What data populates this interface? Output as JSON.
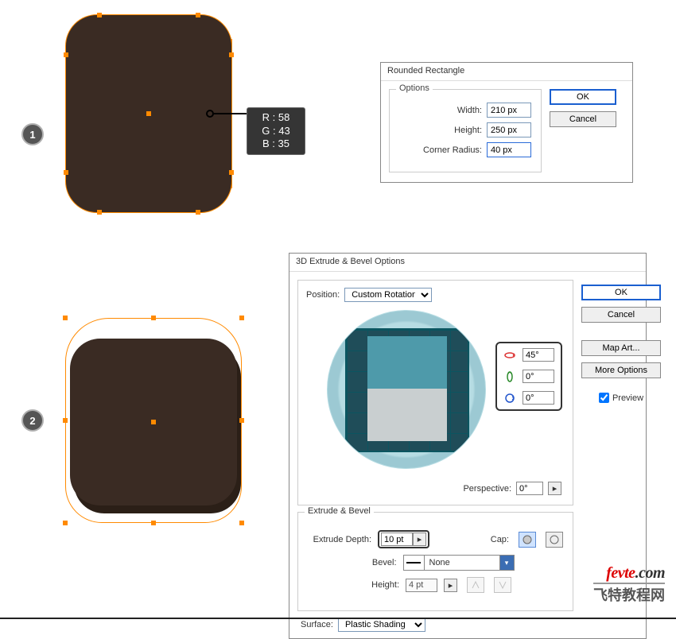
{
  "color_sample": {
    "r": "R : 58",
    "g": "G : 43",
    "b": "B : 35",
    "hex": "#3a2b23"
  },
  "steps": {
    "one": "1",
    "two": "2"
  },
  "dialog_rr": {
    "title": "Rounded Rectangle",
    "fieldset": "Options",
    "width_label": "Width:",
    "width_value": "210 px",
    "height_label": "Height:",
    "height_value": "250 px",
    "radius_label": "Corner Radius:",
    "radius_value": "40 px",
    "ok": "OK",
    "cancel": "Cancel"
  },
  "dialog_3d": {
    "title": "3D Extrude & Bevel Options",
    "position_label": "Position:",
    "position_value": "Custom Rotation",
    "rot_x": "45°",
    "rot_y": "0°",
    "rot_z": "0°",
    "perspective_label": "Perspective:",
    "perspective_value": "0°",
    "eb_legend": "Extrude & Bevel",
    "extrude_label": "Extrude Depth:",
    "extrude_value": "10 pt",
    "cap_label": "Cap:",
    "bevel_label": "Bevel:",
    "bevel_value": "None",
    "height_label": "Height:",
    "height_value": "4 pt",
    "surface_label": "Surface:",
    "surface_value": "Plastic Shading",
    "ok": "OK",
    "cancel": "Cancel",
    "map_art": "Map Art...",
    "more_options": "More Options",
    "preview": "Preview"
  },
  "watermark": {
    "line1a": "fevte",
    "line1b": ".com",
    "line2": "飞特教程网"
  }
}
